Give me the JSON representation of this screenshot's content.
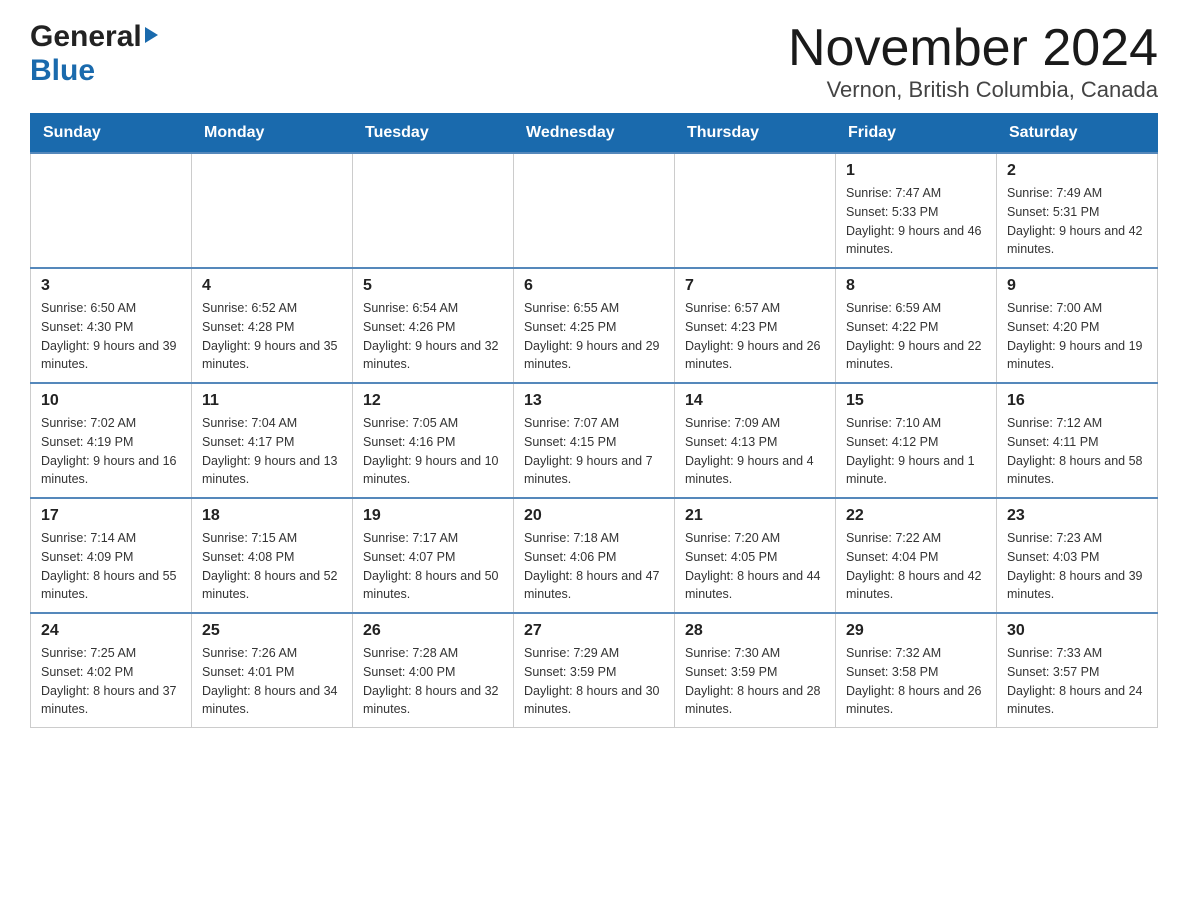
{
  "header": {
    "logo_general": "General",
    "logo_blue": "Blue",
    "month_title": "November 2024",
    "location": "Vernon, British Columbia, Canada"
  },
  "weekdays": [
    "Sunday",
    "Monday",
    "Tuesday",
    "Wednesday",
    "Thursday",
    "Friday",
    "Saturday"
  ],
  "weeks": [
    [
      {
        "day": "",
        "info": ""
      },
      {
        "day": "",
        "info": ""
      },
      {
        "day": "",
        "info": ""
      },
      {
        "day": "",
        "info": ""
      },
      {
        "day": "",
        "info": ""
      },
      {
        "day": "1",
        "info": "Sunrise: 7:47 AM\nSunset: 5:33 PM\nDaylight: 9 hours and 46 minutes."
      },
      {
        "day": "2",
        "info": "Sunrise: 7:49 AM\nSunset: 5:31 PM\nDaylight: 9 hours and 42 minutes."
      }
    ],
    [
      {
        "day": "3",
        "info": "Sunrise: 6:50 AM\nSunset: 4:30 PM\nDaylight: 9 hours and 39 minutes."
      },
      {
        "day": "4",
        "info": "Sunrise: 6:52 AM\nSunset: 4:28 PM\nDaylight: 9 hours and 35 minutes."
      },
      {
        "day": "5",
        "info": "Sunrise: 6:54 AM\nSunset: 4:26 PM\nDaylight: 9 hours and 32 minutes."
      },
      {
        "day": "6",
        "info": "Sunrise: 6:55 AM\nSunset: 4:25 PM\nDaylight: 9 hours and 29 minutes."
      },
      {
        "day": "7",
        "info": "Sunrise: 6:57 AM\nSunset: 4:23 PM\nDaylight: 9 hours and 26 minutes."
      },
      {
        "day": "8",
        "info": "Sunrise: 6:59 AM\nSunset: 4:22 PM\nDaylight: 9 hours and 22 minutes."
      },
      {
        "day": "9",
        "info": "Sunrise: 7:00 AM\nSunset: 4:20 PM\nDaylight: 9 hours and 19 minutes."
      }
    ],
    [
      {
        "day": "10",
        "info": "Sunrise: 7:02 AM\nSunset: 4:19 PM\nDaylight: 9 hours and 16 minutes."
      },
      {
        "day": "11",
        "info": "Sunrise: 7:04 AM\nSunset: 4:17 PM\nDaylight: 9 hours and 13 minutes."
      },
      {
        "day": "12",
        "info": "Sunrise: 7:05 AM\nSunset: 4:16 PM\nDaylight: 9 hours and 10 minutes."
      },
      {
        "day": "13",
        "info": "Sunrise: 7:07 AM\nSunset: 4:15 PM\nDaylight: 9 hours and 7 minutes."
      },
      {
        "day": "14",
        "info": "Sunrise: 7:09 AM\nSunset: 4:13 PM\nDaylight: 9 hours and 4 minutes."
      },
      {
        "day": "15",
        "info": "Sunrise: 7:10 AM\nSunset: 4:12 PM\nDaylight: 9 hours and 1 minute."
      },
      {
        "day": "16",
        "info": "Sunrise: 7:12 AM\nSunset: 4:11 PM\nDaylight: 8 hours and 58 minutes."
      }
    ],
    [
      {
        "day": "17",
        "info": "Sunrise: 7:14 AM\nSunset: 4:09 PM\nDaylight: 8 hours and 55 minutes."
      },
      {
        "day": "18",
        "info": "Sunrise: 7:15 AM\nSunset: 4:08 PM\nDaylight: 8 hours and 52 minutes."
      },
      {
        "day": "19",
        "info": "Sunrise: 7:17 AM\nSunset: 4:07 PM\nDaylight: 8 hours and 50 minutes."
      },
      {
        "day": "20",
        "info": "Sunrise: 7:18 AM\nSunset: 4:06 PM\nDaylight: 8 hours and 47 minutes."
      },
      {
        "day": "21",
        "info": "Sunrise: 7:20 AM\nSunset: 4:05 PM\nDaylight: 8 hours and 44 minutes."
      },
      {
        "day": "22",
        "info": "Sunrise: 7:22 AM\nSunset: 4:04 PM\nDaylight: 8 hours and 42 minutes."
      },
      {
        "day": "23",
        "info": "Sunrise: 7:23 AM\nSunset: 4:03 PM\nDaylight: 8 hours and 39 minutes."
      }
    ],
    [
      {
        "day": "24",
        "info": "Sunrise: 7:25 AM\nSunset: 4:02 PM\nDaylight: 8 hours and 37 minutes."
      },
      {
        "day": "25",
        "info": "Sunrise: 7:26 AM\nSunset: 4:01 PM\nDaylight: 8 hours and 34 minutes."
      },
      {
        "day": "26",
        "info": "Sunrise: 7:28 AM\nSunset: 4:00 PM\nDaylight: 8 hours and 32 minutes."
      },
      {
        "day": "27",
        "info": "Sunrise: 7:29 AM\nSunset: 3:59 PM\nDaylight: 8 hours and 30 minutes."
      },
      {
        "day": "28",
        "info": "Sunrise: 7:30 AM\nSunset: 3:59 PM\nDaylight: 8 hours and 28 minutes."
      },
      {
        "day": "29",
        "info": "Sunrise: 7:32 AM\nSunset: 3:58 PM\nDaylight: 8 hours and 26 minutes."
      },
      {
        "day": "30",
        "info": "Sunrise: 7:33 AM\nSunset: 3:57 PM\nDaylight: 8 hours and 24 minutes."
      }
    ]
  ]
}
